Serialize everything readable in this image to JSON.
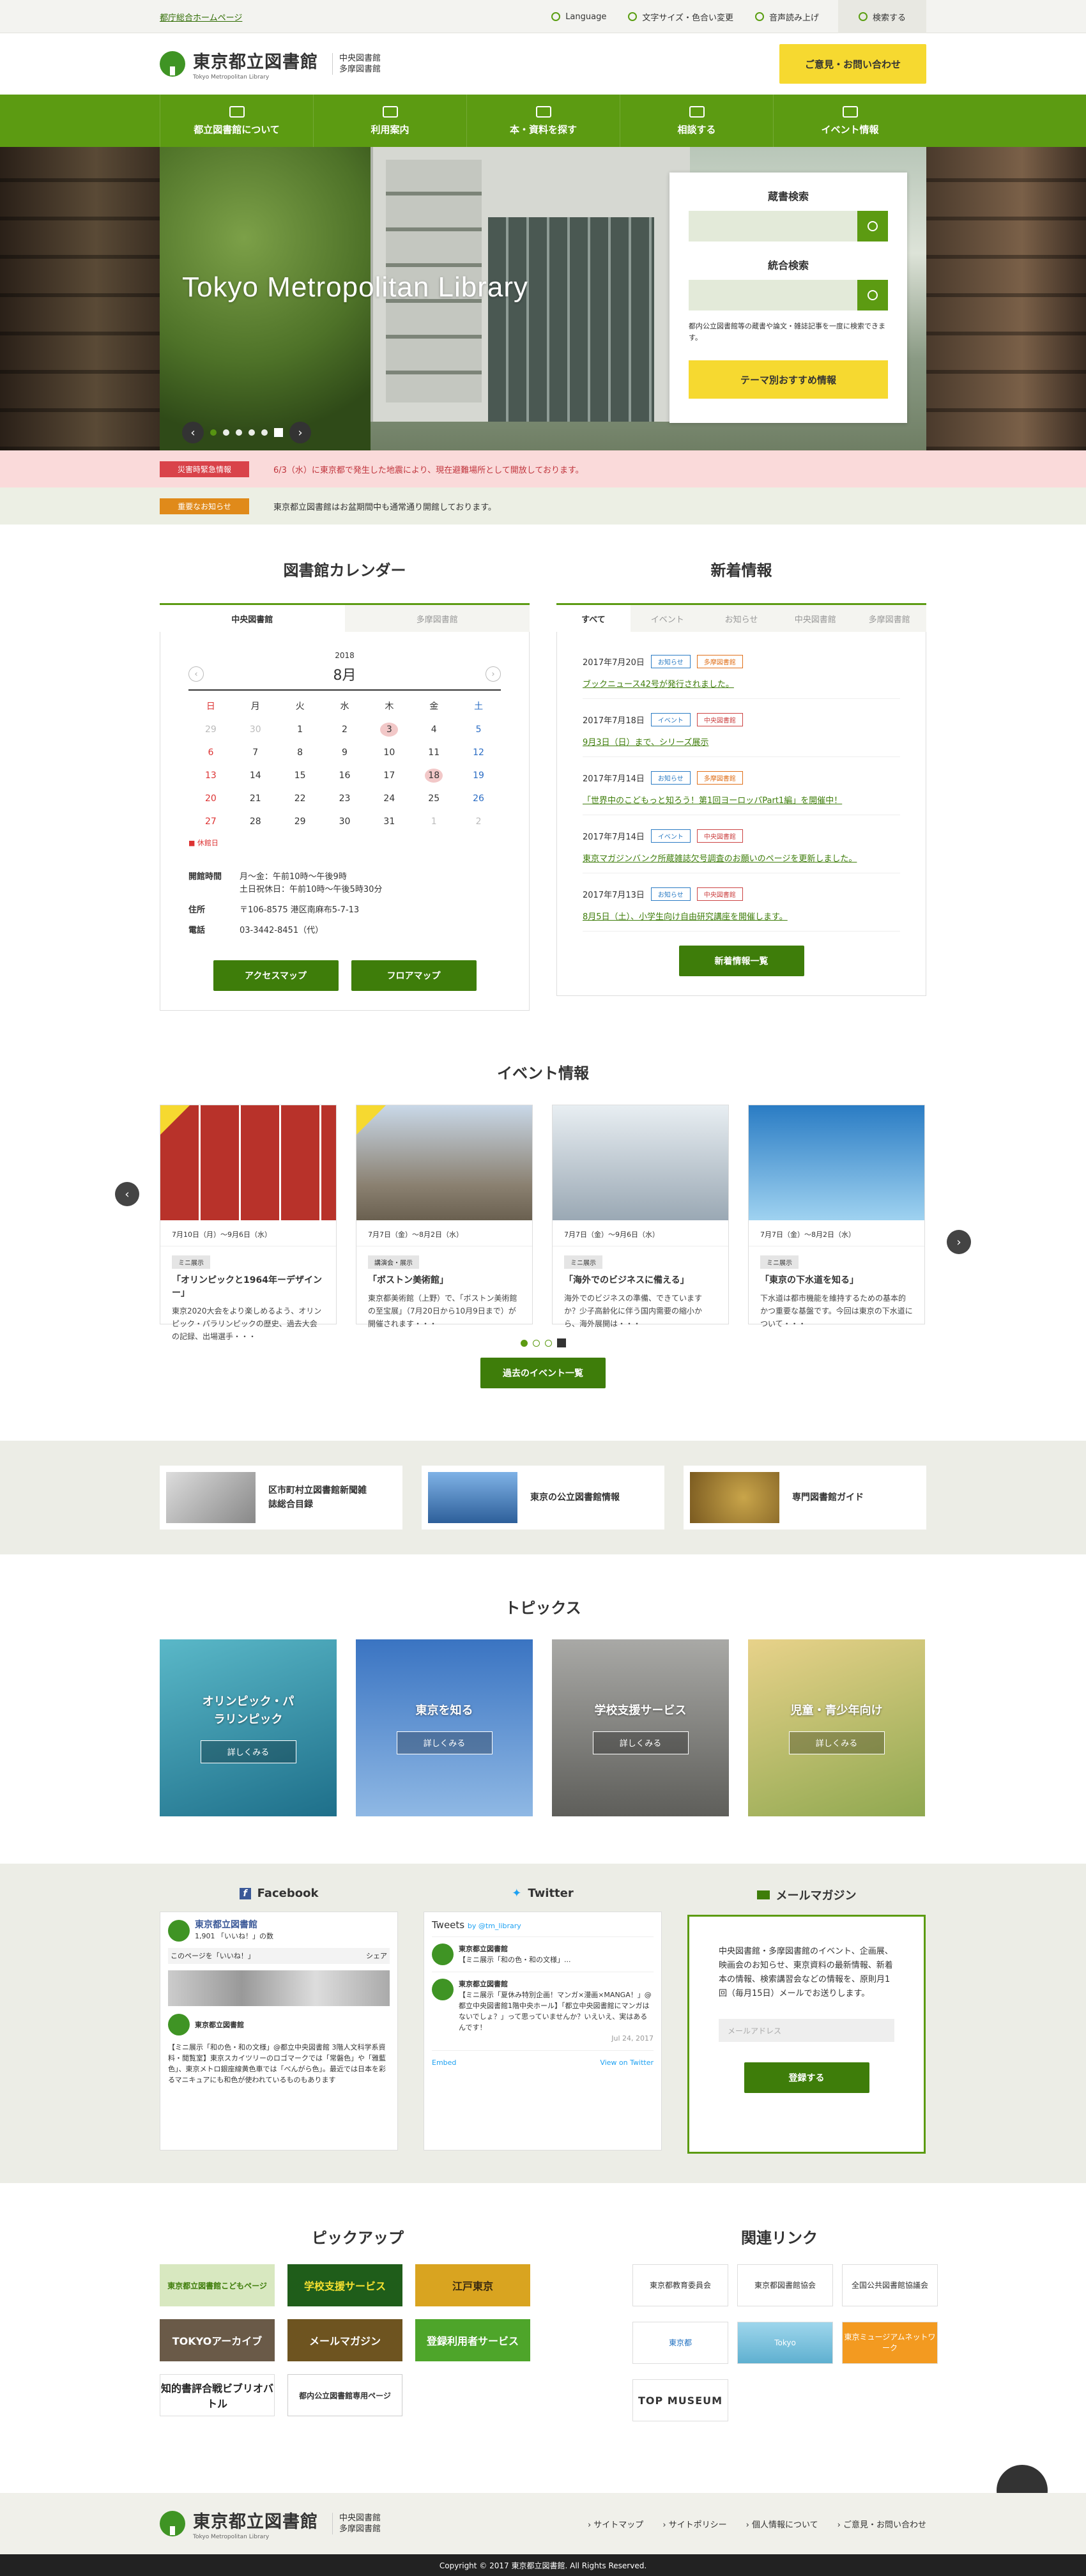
{
  "util": {
    "gov_link": "都庁総合ホームページ",
    "language": "Language",
    "text_size": "文字サイズ・色合い変更",
    "voice": "音声読み上げ",
    "search": "検索する"
  },
  "header": {
    "logo_name": "東京都立図書館",
    "logo_en": "Tokyo Metropolitan Library",
    "branch1": "中央図書館",
    "branch2": "多摩図書館",
    "contact": "ご意見・お問い合わせ"
  },
  "nav": [
    "都立図書館について",
    "利用案内",
    "本・資料を探す",
    "相談する",
    "イベント情報"
  ],
  "hero": {
    "title": "Tokyo Metropolitan Library",
    "prev": "‹",
    "next": "›"
  },
  "search": {
    "catalog_title": "蔵書検索",
    "unified_title": "統合検索",
    "desc": "都内公立図書館等の蔵書や論文・雑誌記事を一度に検索できます。",
    "theme_button": "テーマ別おすすめ情報"
  },
  "alerts": {
    "disaster_tag": "災害時緊急情報",
    "disaster_text": "6/3（水）に東京都で発生した地震により、現在避難場所として開放しております。",
    "notice_tag": "重要なお知らせ",
    "notice_text": "東京都立図書館はお盆期間中も通常通り開館しております。"
  },
  "calendar": {
    "title": "図書館カレンダー",
    "tabs": [
      "中央図書館",
      "多摩図書館"
    ],
    "year": "2018",
    "month": "8月",
    "weekdays": [
      "日",
      "月",
      "火",
      "水",
      "木",
      "金",
      "土"
    ],
    "days": [
      "29",
      "30",
      "1",
      "2",
      "3",
      "4",
      "5",
      "6",
      "7",
      "8",
      "9",
      "10",
      "11",
      "12",
      "13",
      "14",
      "15",
      "16",
      "17",
      "18",
      "19",
      "20",
      "21",
      "22",
      "23",
      "24",
      "25",
      "26",
      "27",
      "28",
      "29",
      "30",
      "31",
      "1",
      "2"
    ],
    "legend": "休館日",
    "hours_label": "開館時間",
    "hours_1": "月〜金：午前10時〜午後9時",
    "hours_2": "土日祝休日：午前10時〜午後5時30分",
    "addr_label": "住所",
    "addr": "〒106-8575 港区南麻布5-7-13",
    "tel_label": "電話",
    "tel": "03-3442-8451（代）",
    "access_button": "アクセスマップ",
    "floor_button": "フロアマップ"
  },
  "news": {
    "title": "新着情報",
    "tabs": [
      "すべて",
      "イベント",
      "お知らせ",
      "中央図書館",
      "多摩図書館"
    ],
    "items": [
      {
        "date": "2017年7月20日",
        "tag1": "お知らせ",
        "tag2": "多摩図書館",
        "text": "ブックニュース42号が発行されました。"
      },
      {
        "date": "2017年7月18日",
        "tag1": "イベント",
        "tag2": "中央図書館",
        "text": "9月3日（日）まで、シリーズ展示"
      },
      {
        "date": "2017年7月14日",
        "tag1": "お知らせ",
        "tag2": "多摩図書館",
        "text": "「世界中のこどもっと知ろう！第1回ヨーロッパPart1編」を開催中！"
      },
      {
        "date": "2017年7月14日",
        "tag1": "イベント",
        "tag2": "中央図書館",
        "text": "東京マガジンバンク所蔵雑誌欠号調査のお願いのページを更新しました。"
      },
      {
        "date": "2017年7月13日",
        "tag1": "お知らせ",
        "tag2": "中央図書館",
        "text": "8月5日（土）、小学生向け自由研究講座を開催します。"
      }
    ],
    "more_button": "新着情報一覧"
  },
  "events": {
    "title": "イベント情報",
    "cards": [
      {
        "date": "7月10日（月）〜9月6日（水）",
        "type": "ミニ展示",
        "title": "「オリンピックと1964年ーデザインー」",
        "desc": "東京2020大会をより楽しめるよう、オリンピック・パラリンピックの歴史、過去大会の記録、出場選手・・・"
      },
      {
        "date": "7月7日（金）〜8月2日（水）",
        "type": "講演会・展示",
        "title": "「ボストン美術館」",
        "desc": "東京都美術館（上野）で、「ボストン美術館の至宝展」（7月20日から10月9日まで）が開催されます・・・"
      },
      {
        "date": "7月7日（金）〜9月6日（水）",
        "type": "ミニ展示",
        "title": "「海外でのビジネスに備える」",
        "desc": "海外でのビジネスの準備、できていますか？少子高齢化に伴う国内需要の縮小から、海外展開は・・・"
      },
      {
        "date": "7月7日（金）〜8月2日（水）",
        "type": "ミニ展示",
        "title": "「東京の下水道を知る」",
        "desc": "下水道は都市機能を維持するための基本的かつ重要な基盤です。今回は東京の下水道について・・・"
      }
    ],
    "past_button": "過去のイベント一覧"
  },
  "banners": [
    "区市町村立図書館新聞雑誌総合目録",
    "東京の公立図書館情報",
    "専門図書館ガイド"
  ],
  "topics": {
    "title": "トピックス",
    "items": [
      "オリンピック・パラリンピック",
      "東京を知る",
      "学校支援サービス",
      "児童・青少年向け"
    ],
    "more": "詳しくみる"
  },
  "social": {
    "facebook": "Facebook",
    "twitter": "Twitter",
    "mail": "メールマガジン",
    "fb_page": "東京都立図書館",
    "fb_likes": "1,901 「いいね！」の数",
    "fb_like_btn": "このページを「いいね！」",
    "fb_share": "シェア",
    "fb_post": "【ミニ展示「和の色・和の文様」@都立中央図書館 3階人文科学系資料・閲覧室】東京スカイツリーのロゴマークでは「常磐色」や「雅藍色」、東京メトロ銀座線黄色車では「べんがら色」。最近では日本を彩るマニキュアにも和色が使われているものもあります",
    "tw_head": "Tweets",
    "tw_handle": "by @tm_library",
    "tw_1": "【ミニ展示「和の色・和の文様」...",
    "tw_2": "【ミニ展示「夏休み特別企画！マンガ×漫画×MANGA！」@都立中央図書館1階中央ホール】「都立中央図書館にマンガはないでしょ？」って思っていませんか？いえいえ、実はあるんです！",
    "tw_date": "Jul 24, 2017",
    "tw_embed": "Embed",
    "tw_view": "View on Twitter",
    "mail_text": "中央図書館・多摩図書館のイベント、企画展、映画会のお知らせ、東京資料の最新情報、新着本の情報、検索講習会などの情報を、原則月1回（毎月15日）メールでお送りします。",
    "mail_placeholder": "メールアドレス",
    "mail_button": "登録する"
  },
  "pickup": {
    "title": "ピックアップ",
    "items": [
      "東京都立図書館こどもページ",
      "学校支援サービス",
      "江戸東京",
      "TOKYOアーカイブ",
      "メールマガジン",
      "登録利用者サービス",
      "知的書評合戦ビブリオバトル",
      "都内公立図書館専用ページ"
    ]
  },
  "links": {
    "title": "関連リンク",
    "items": [
      "東京都教育委員会",
      "東京都図書館協会",
      "全国公共図書館協議会",
      "東京都",
      "Tokyo",
      "東京ミュージアムネットワーク",
      "TOP MUSEUM"
    ]
  },
  "footer": {
    "links": [
      "サイトマップ",
      "サイトポリシー",
      "個人情報について",
      "ご意見・お問い合わせ"
    ],
    "copyright": "Copyright © 2017 東京都立図書館. All Rights Reserved.",
    "top": "︿"
  }
}
